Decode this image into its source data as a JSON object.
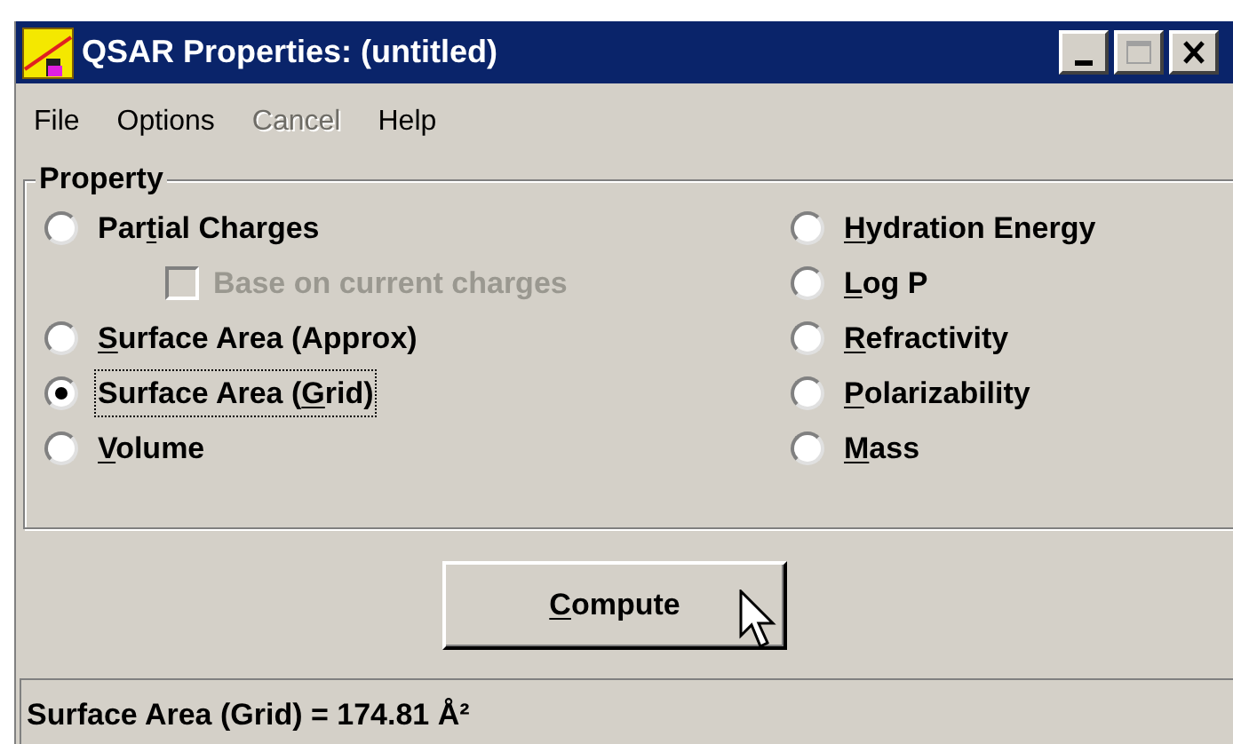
{
  "window": {
    "title": "QSAR Properties: (untitled)"
  },
  "menu": [
    {
      "label": "File",
      "disabled": false
    },
    {
      "label": "Options",
      "disabled": false
    },
    {
      "label": "Cancel",
      "disabled": true
    },
    {
      "label": "Help",
      "disabled": false
    }
  ],
  "property_group": {
    "title": "Property",
    "left": [
      {
        "kind": "radio",
        "pre": "Par",
        "key": "t",
        "post": "ial Charges",
        "selected": false
      },
      {
        "kind": "checkbox",
        "post": "Base on current charges",
        "checked": false,
        "disabled": true
      },
      {
        "kind": "radio",
        "key": "S",
        "post": "urface Area (Approx)",
        "selected": false
      },
      {
        "kind": "radio",
        "pre": "Surface Area (",
        "key": "G",
        "post": "rid)",
        "selected": true
      },
      {
        "kind": "radio",
        "key": "V",
        "post": "olume",
        "selected": false
      }
    ],
    "right": [
      {
        "kind": "radio",
        "key": "H",
        "post": "ydration Energy",
        "selected": false
      },
      {
        "kind": "radio",
        "key": "L",
        "post": "og P",
        "selected": false
      },
      {
        "kind": "radio",
        "key": "R",
        "post": "efractivity",
        "selected": false
      },
      {
        "kind": "radio",
        "key": "P",
        "post": "olarizability",
        "selected": false
      },
      {
        "kind": "radio",
        "key": "M",
        "post": "ass",
        "selected": false
      }
    ]
  },
  "compute_button": {
    "key": "C",
    "post": "ompute"
  },
  "status_bar": "Surface Area (Grid) = 174.81 Å²"
}
